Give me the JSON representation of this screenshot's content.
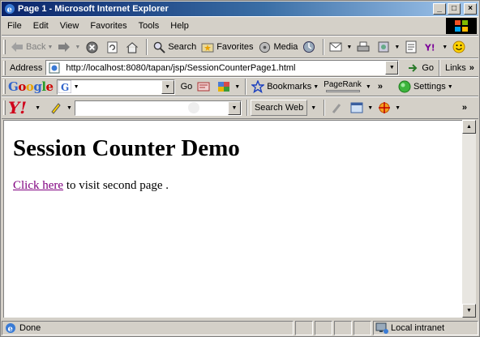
{
  "window": {
    "title": "Page 1 - Microsoft Internet Explorer",
    "controls": {
      "minimize": "_",
      "maximize": "□",
      "close": "×"
    }
  },
  "menu": [
    "File",
    "Edit",
    "View",
    "Favorites",
    "Tools",
    "Help"
  ],
  "toolbar": {
    "back": "Back",
    "search": "Search",
    "favorites": "Favorites",
    "media": "Media"
  },
  "address": {
    "label": "Address",
    "url": "http://localhost:8080/tapan/jsp/SessionCounterPage1.html",
    "go": "Go",
    "links": "Links"
  },
  "google": {
    "logo": "Google",
    "go": "Go",
    "bookmarks": "Bookmarks",
    "pagerank": "PageRank",
    "settings": "Settings"
  },
  "yahoo": {
    "logo": "Y!",
    "search_web": "Search Web"
  },
  "page": {
    "heading": "Session Counter Demo",
    "link_text": "Click here",
    "after_link": " to visit second page ."
  },
  "status": {
    "text": "Done",
    "zone": "Local intranet"
  },
  "colors": {
    "title_start": "#0a246a",
    "title_end": "#a6caf0",
    "visited_link": "#800080",
    "chrome": "#d4d0c8"
  },
  "icons": [
    "ie-icon",
    "back-arrow-icon",
    "forward-arrow-icon",
    "stop-icon",
    "refresh-icon",
    "home-icon",
    "search-icon",
    "favorites-icon",
    "media-icon",
    "history-icon",
    "mail-icon",
    "print-icon",
    "edit-icon",
    "discuss-icon",
    "messenger-icon",
    "page-icon",
    "go-icon",
    "google-g-icon",
    "bookmark-star-icon",
    "settings-icon",
    "yahoo-icon",
    "highlight-icon",
    "zone-icon"
  ]
}
